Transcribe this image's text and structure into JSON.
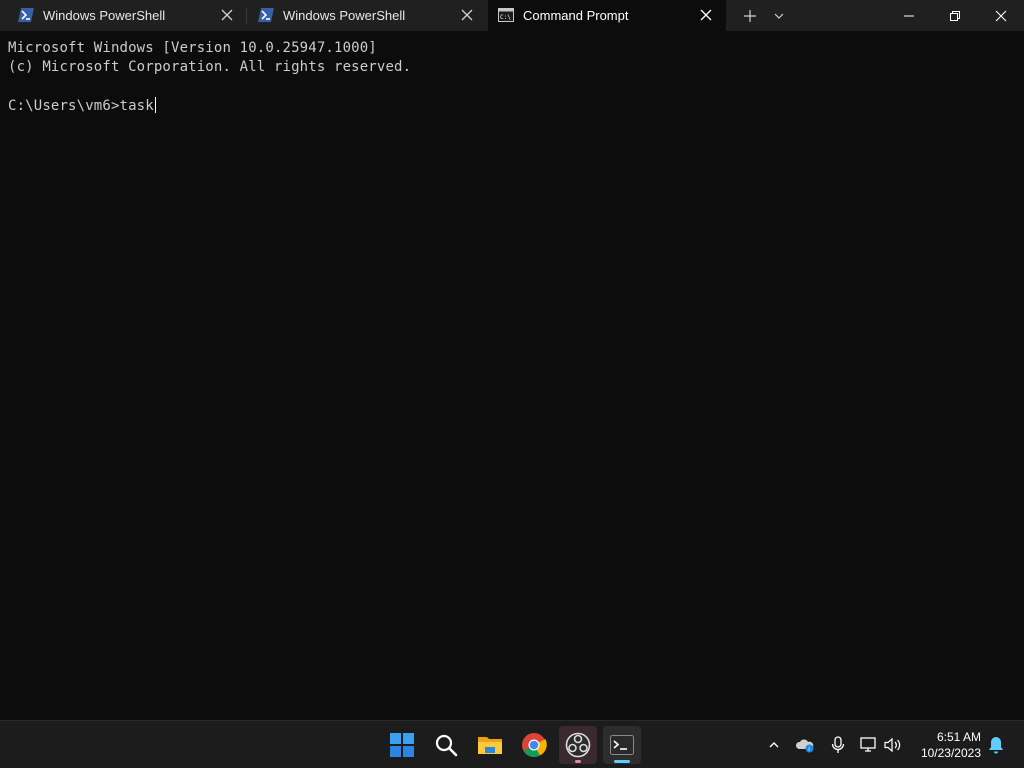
{
  "tabs": [
    {
      "label": "Windows PowerShell",
      "icon": "powershell-icon",
      "active": false
    },
    {
      "label": "Windows PowerShell",
      "icon": "powershell-icon",
      "active": false
    },
    {
      "label": "Command Prompt",
      "icon": "cmd-icon",
      "active": true
    }
  ],
  "terminal": {
    "lines": [
      "Microsoft Windows [Version 10.0.25947.1000]",
      "(c) Microsoft Corporation. All rights reserved.",
      "",
      "C:\\Users\\vm6>task"
    ]
  },
  "taskbar": {
    "apps": [
      "start-icon",
      "search-icon",
      "file-explorer-icon",
      "chrome-icon",
      "obs-icon",
      "terminal-icon"
    ],
    "tray": [
      "chevron-up-icon",
      "onedrive-icon",
      "microphone-icon",
      "network-icon",
      "volume-icon",
      "notification-bell-icon"
    ],
    "time": "6:51 AM",
    "date": "10/23/2023"
  },
  "colors": {
    "terminal_bg": "#0c0c0c",
    "titlebar_bg": "#202020",
    "taskbar_bg": "#1c1c1c",
    "accent": "#60cdff"
  }
}
